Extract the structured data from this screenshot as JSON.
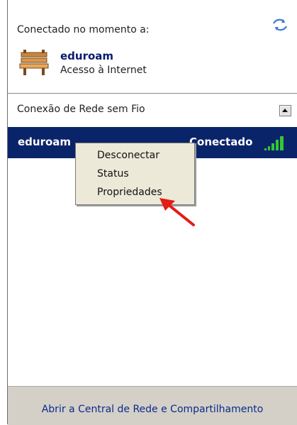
{
  "connected_header": "Conectado no momento a:",
  "current_network": {
    "name": "eduroam",
    "status": "Acesso à Internet"
  },
  "section": {
    "title": "Conexão de Rede sem Fio"
  },
  "network_row": {
    "name": "eduroam",
    "state": "Conectado"
  },
  "context_menu": {
    "items": [
      "Desconectar",
      "Status",
      "Propriedades"
    ]
  },
  "footer": {
    "link": "Abrir a Central de Rede e Compartilhamento"
  },
  "colors": {
    "selected_row": "#0a246a",
    "footer_bg": "#d4d0c8",
    "menu_bg": "#ece9d8",
    "arrow": "#e41b17",
    "signal": "#35c635"
  },
  "icons": {
    "refresh": "refresh-icon",
    "network": "bench-network-icon",
    "signal": "signal-strength-icon",
    "collapse": "collapse-icon"
  }
}
